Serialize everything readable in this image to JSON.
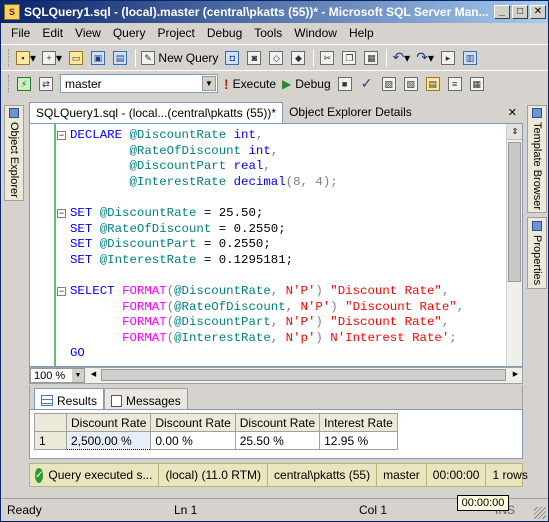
{
  "window": {
    "title": "SQLQuery1.sql - (local).master (central\\pkatts (55))* - Microsoft SQL Server Man...",
    "buttons": [
      "_",
      "□",
      "✕"
    ]
  },
  "menu": [
    "File",
    "Edit",
    "View",
    "Query",
    "Project",
    "Debug",
    "Tools",
    "Window",
    "Help"
  ],
  "toolbar1": {
    "new_query_label": "New Query"
  },
  "toolbar2": {
    "database": "master",
    "execute_label": "Execute",
    "debug_label": "Debug"
  },
  "left_panel": {
    "object_explorer": "Object Explorer"
  },
  "right_panel": {
    "template_browser": "Template Browser",
    "properties": "Properties"
  },
  "doc_tabs": {
    "active": "SQLQuery1.sql - (local...(central\\pkatts (55))*",
    "inactive": "Object Explorer Details",
    "close": "✕"
  },
  "editor": {
    "zoom": "100 %",
    "code_lines": [
      [
        {
          "t": "DECLARE ",
          "c": "kw"
        },
        {
          "t": "@DiscountRate ",
          "c": "var"
        },
        {
          "t": "int",
          "c": "kw"
        },
        {
          "t": ",",
          "c": "gray"
        }
      ],
      [
        {
          "t": "        "
        },
        {
          "t": "@RateOfDiscount ",
          "c": "var"
        },
        {
          "t": "int",
          "c": "kw"
        },
        {
          "t": ",",
          "c": "gray"
        }
      ],
      [
        {
          "t": "        "
        },
        {
          "t": "@DiscountPart ",
          "c": "var"
        },
        {
          "t": "real",
          "c": "kw"
        },
        {
          "t": ",",
          "c": "gray"
        }
      ],
      [
        {
          "t": "        "
        },
        {
          "t": "@InterestRate ",
          "c": "var"
        },
        {
          "t": "decimal",
          "c": "kw"
        },
        {
          "t": "(8, 4);",
          "c": "gray"
        }
      ],
      [
        {
          "t": ""
        }
      ],
      [
        {
          "t": "SET ",
          "c": "kw"
        },
        {
          "t": "@DiscountRate ",
          "c": "var"
        },
        {
          "t": "= 25.50;"
        }
      ],
      [
        {
          "t": "SET ",
          "c": "kw"
        },
        {
          "t": "@RateOfDiscount ",
          "c": "var"
        },
        {
          "t": "= 0.2550;"
        }
      ],
      [
        {
          "t": "SET ",
          "c": "kw"
        },
        {
          "t": "@DiscountPart ",
          "c": "var"
        },
        {
          "t": "= 0.2550;"
        }
      ],
      [
        {
          "t": "SET ",
          "c": "kw"
        },
        {
          "t": "@InterestRate ",
          "c": "var"
        },
        {
          "t": "= 0.1295181;"
        }
      ],
      [
        {
          "t": ""
        }
      ],
      [
        {
          "t": "SELECT ",
          "c": "kw"
        },
        {
          "t": "FORMAT",
          "c": "fn"
        },
        {
          "t": "(",
          "c": "gray"
        },
        {
          "t": "@DiscountRate",
          "c": "var"
        },
        {
          "t": ", ",
          "c": "gray"
        },
        {
          "t": "N'P'",
          "c": "str"
        },
        {
          "t": ") ",
          "c": "gray"
        },
        {
          "t": "\"Discount Rate\"",
          "c": "str"
        },
        {
          "t": ",",
          "c": "gray"
        }
      ],
      [
        {
          "t": "       "
        },
        {
          "t": "FORMAT",
          "c": "fn"
        },
        {
          "t": "(",
          "c": "gray"
        },
        {
          "t": "@RateOfDiscount",
          "c": "var"
        },
        {
          "t": ", ",
          "c": "gray"
        },
        {
          "t": "N'P'",
          "c": "str"
        },
        {
          "t": ") ",
          "c": "gray"
        },
        {
          "t": "\"Discount Rate\"",
          "c": "str"
        },
        {
          "t": ",",
          "c": "gray"
        }
      ],
      [
        {
          "t": "       "
        },
        {
          "t": "FORMAT",
          "c": "fn"
        },
        {
          "t": "(",
          "c": "gray"
        },
        {
          "t": "@DiscountPart",
          "c": "var"
        },
        {
          "t": ", ",
          "c": "gray"
        },
        {
          "t": "N'P'",
          "c": "str"
        },
        {
          "t": ") ",
          "c": "gray"
        },
        {
          "t": "\"Discount Rate\"",
          "c": "str"
        },
        {
          "t": ",",
          "c": "gray"
        }
      ],
      [
        {
          "t": "       "
        },
        {
          "t": "FORMAT",
          "c": "fn"
        },
        {
          "t": "(",
          "c": "gray"
        },
        {
          "t": "@InterestRate",
          "c": "var"
        },
        {
          "t": ", ",
          "c": "gray"
        },
        {
          "t": "N'p'",
          "c": "str"
        },
        {
          "t": ") ",
          "c": "gray"
        },
        {
          "t": "N'Interest Rate'",
          "c": "str"
        },
        {
          "t": ";",
          "c": "gray"
        }
      ],
      [
        {
          "t": "GO",
          "c": "kw"
        }
      ]
    ]
  },
  "results": {
    "tabs": {
      "results": "Results",
      "messages": "Messages"
    },
    "columns": [
      "Discount Rate",
      "Discount Rate",
      "Discount Rate",
      "Interest Rate"
    ],
    "rows": [
      {
        "num": "1",
        "cells": [
          "2,500.00 %",
          "0.00 %",
          "25.50 %",
          "12.95 %"
        ]
      }
    ]
  },
  "query_status": {
    "message": "Query executed s...",
    "server": "(local) (11.0 RTM)",
    "user": "central\\pkatts (55)",
    "database": "master",
    "elapsed": "00:00:00",
    "rows": "1 rows"
  },
  "statusbar": {
    "ready": "Ready",
    "ln": "Ln 1",
    "col": "Col 1",
    "ins": "INS",
    "tooltip": "00:00:00"
  },
  "colors": {
    "keyword": "#0000ff",
    "function": "#ff00ff",
    "variable": "#008080",
    "string": "#ff0000",
    "status_ok": "#2f9b2f"
  }
}
